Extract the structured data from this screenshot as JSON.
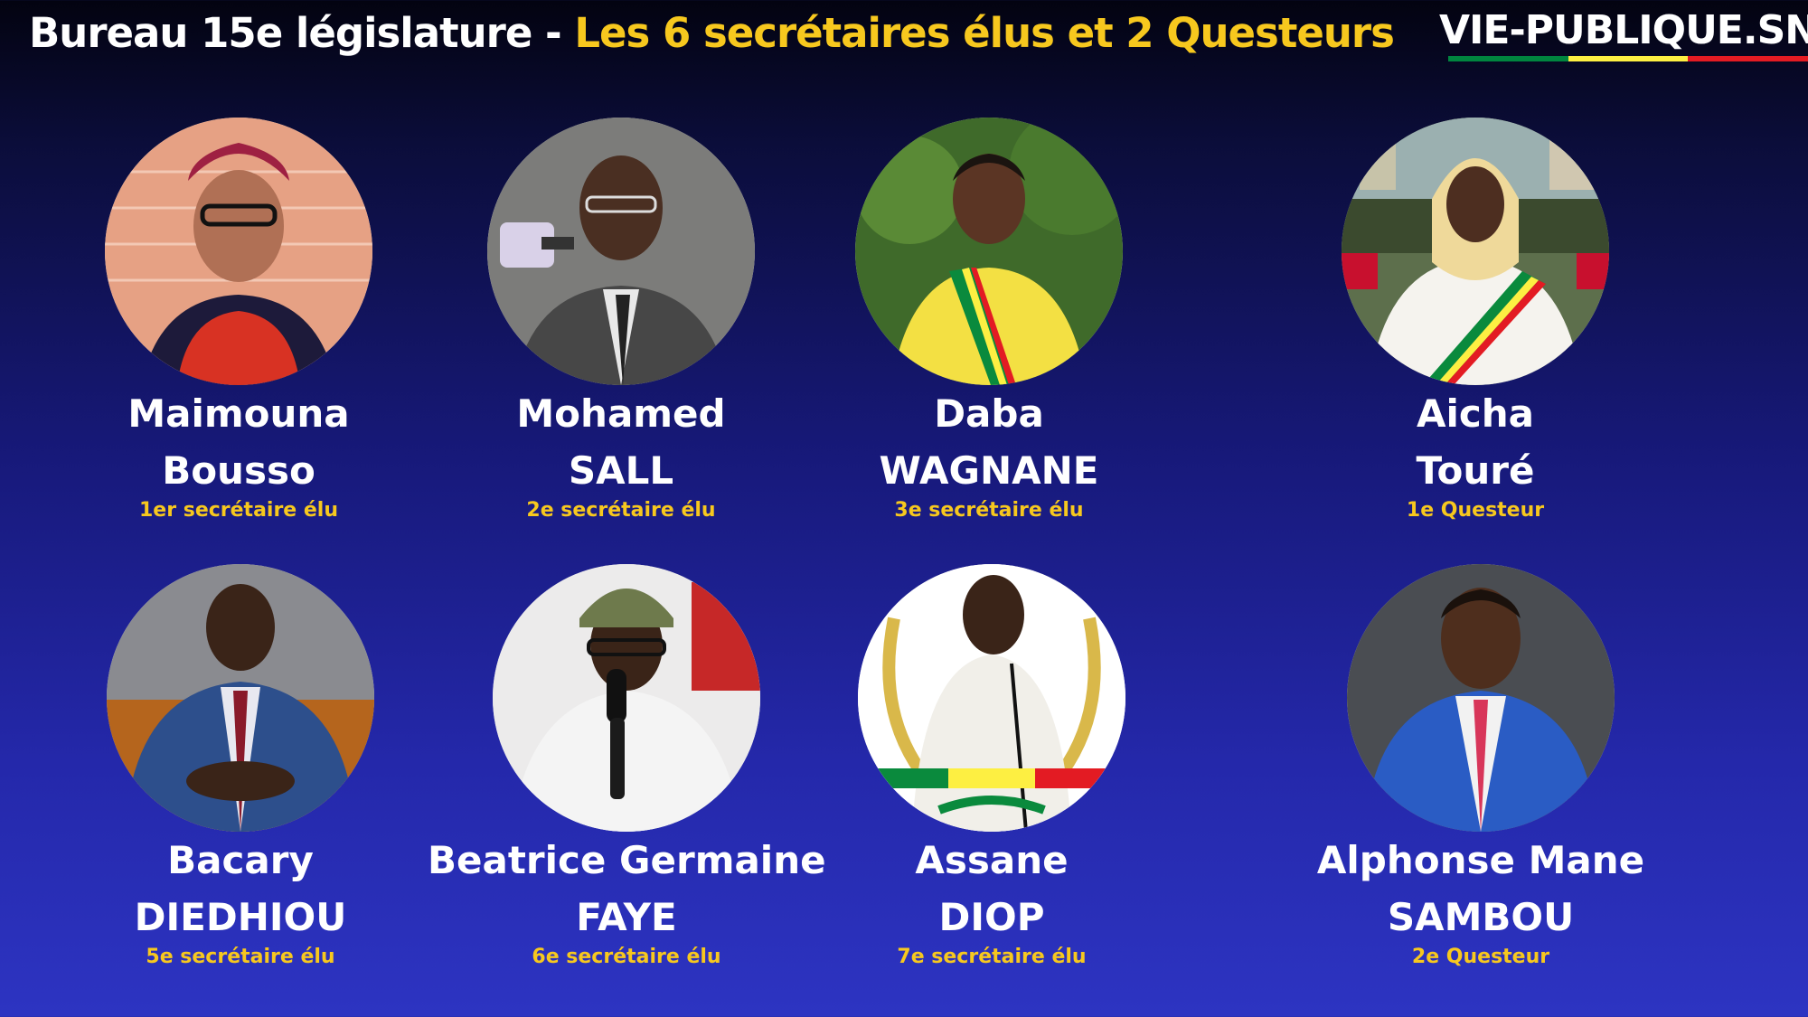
{
  "header": {
    "title_main": "Bureau 15e législature - ",
    "title_highlight": "Les 6 secrétaires élus et 2 Questeurs",
    "brand": "VIE-PUBLIQUE.SN"
  },
  "colors": {
    "accent_yellow": "#f7c81e",
    "flag_green": "#00853f",
    "flag_yellow": "#fdef42",
    "flag_red": "#e31b23"
  },
  "members": [
    {
      "first": "Maimouna",
      "last": "Bousso",
      "role": "1er secrétaire élu"
    },
    {
      "first": "Mohamed",
      "last": "SALL",
      "role": "2e secrétaire élu"
    },
    {
      "first": "Daba",
      "last": "WAGNANE",
      "role": "3e secrétaire élu"
    },
    {
      "first": "Aicha",
      "last": "Touré",
      "role": "1e Questeur"
    },
    {
      "first": "Bacary",
      "last": "DIEDHIOU",
      "role": "5e secrétaire élu"
    },
    {
      "first": "Beatrice Germaine",
      "last": "FAYE",
      "role": "6e  secrétaire élu"
    },
    {
      "first": "Assane",
      "last": "DIOP",
      "role": "7e secrétaire élu"
    },
    {
      "first": "Alphonse Mane",
      "last": "SAMBOU",
      "role": "2e Questeur"
    }
  ]
}
